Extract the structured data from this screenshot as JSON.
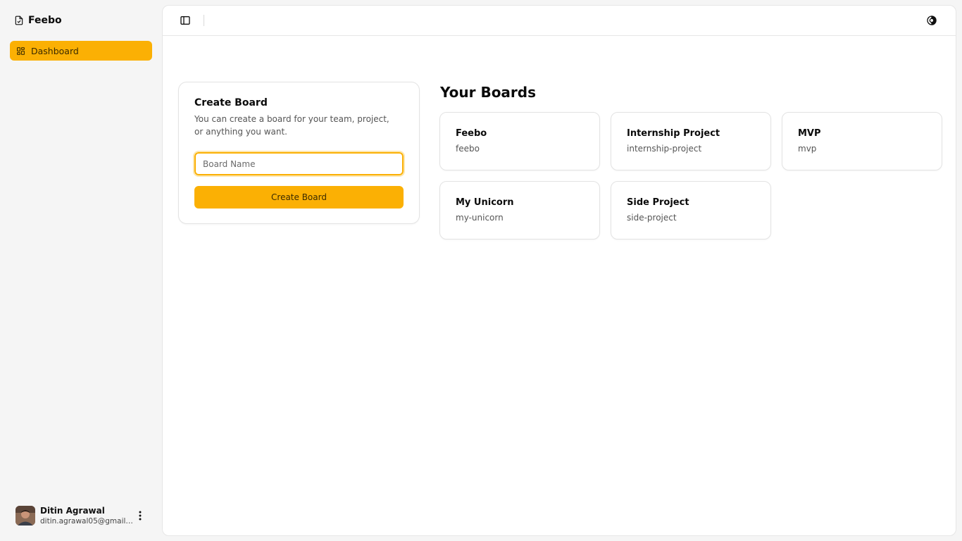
{
  "sidebar": {
    "brand": "Feebo",
    "nav": [
      {
        "label": "Dashboard",
        "icon": "layout-grid-icon",
        "active": true
      }
    ],
    "user": {
      "name": "Ditin Agrawal",
      "email": "ditin.agrawal05@gmail.co..."
    }
  },
  "topbar": {
    "left_icon": "sidebar-toggle-icon",
    "right_icon": "theme-toggle-icon"
  },
  "create_board": {
    "title": "Create Board",
    "description": "You can create a board for your team, project, or anything you want.",
    "input_placeholder": "Board Name",
    "input_value": "",
    "button_label": "Create Board"
  },
  "boards": {
    "title": "Your Boards",
    "items": [
      {
        "name": "Feebo",
        "slug": "feebo"
      },
      {
        "name": "Internship Project",
        "slug": "internship-project"
      },
      {
        "name": "MVP",
        "slug": "mvp"
      },
      {
        "name": "My Unicorn",
        "slug": "my-unicorn"
      },
      {
        "name": "Side Project",
        "slug": "side-project"
      }
    ]
  },
  "colors": {
    "accent": "#fbb004",
    "background": "#f5f5f5",
    "panel": "#ffffff"
  }
}
